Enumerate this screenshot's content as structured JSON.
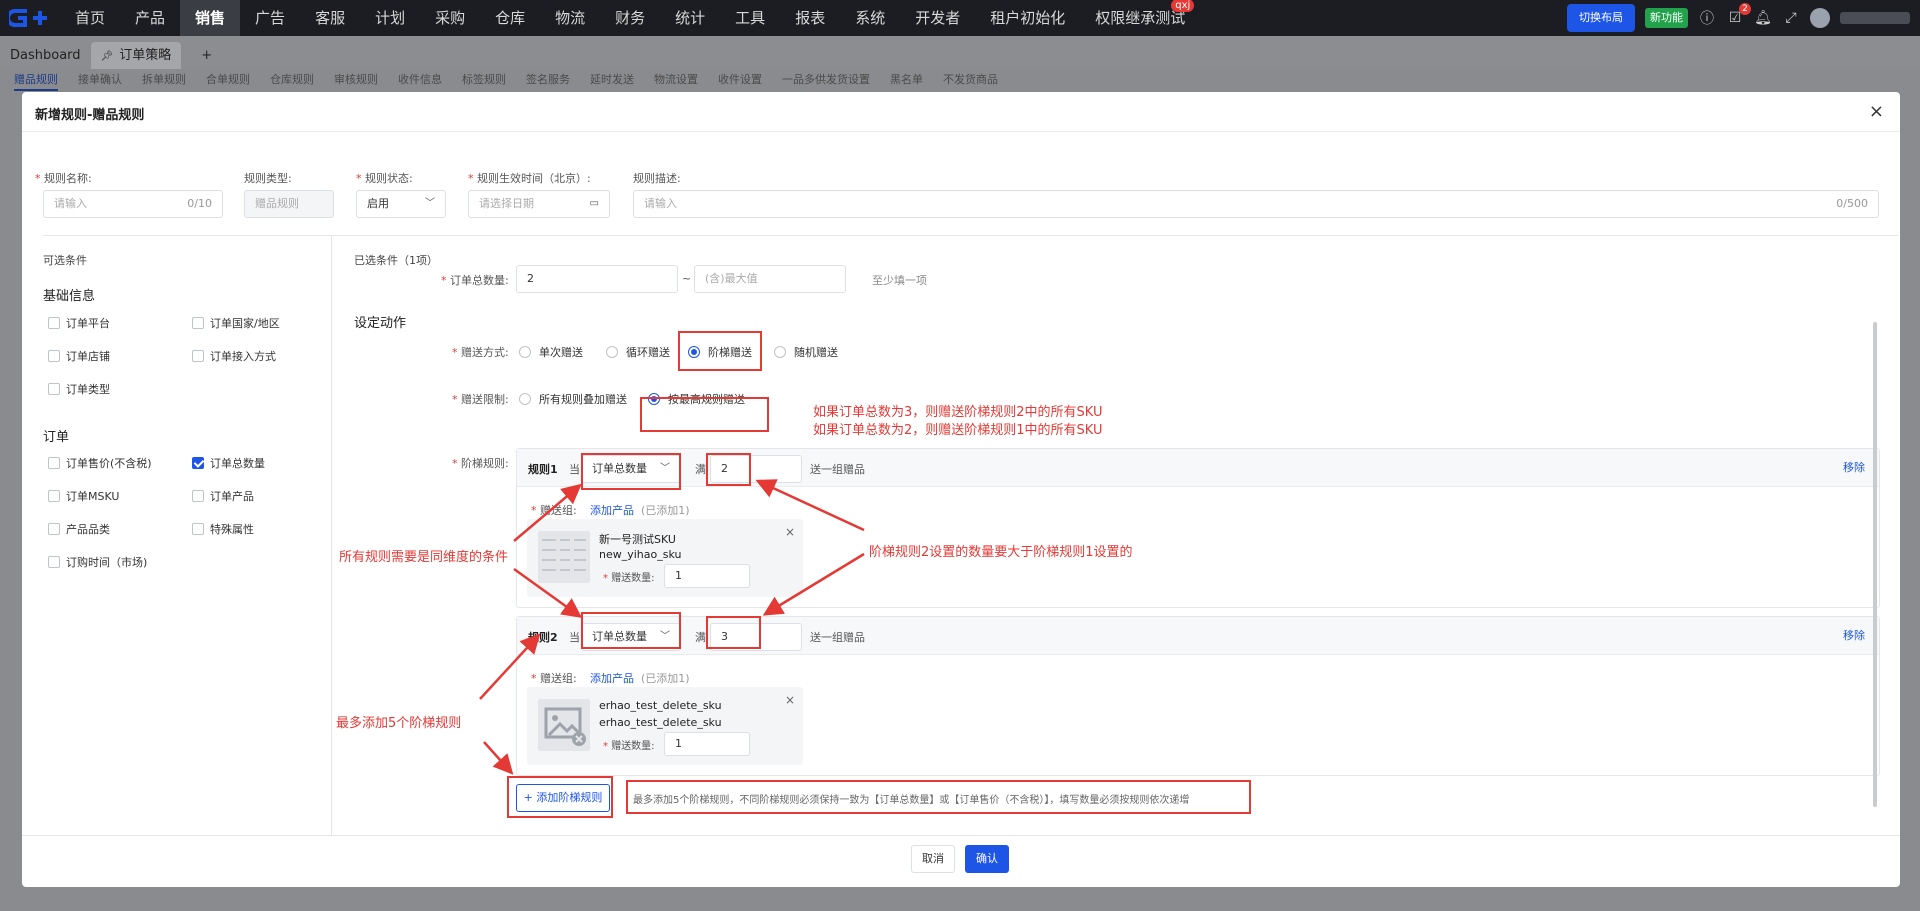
{
  "topnav": {
    "items": [
      "首页",
      "产品",
      "销售",
      "广告",
      "客服",
      "计划",
      "采购",
      "仓库",
      "物流",
      "财务",
      "统计",
      "工具",
      "报表",
      "系统",
      "开发者",
      "租户初始化",
      "权限继承测试"
    ],
    "active_index": 2,
    "badge_label": "qxj",
    "switch_layout": "切换布局",
    "new_feature": "新功能",
    "notification_count": "2"
  },
  "tabs": [
    {
      "label": "Dashboard"
    },
    {
      "label": "订单策略"
    }
  ],
  "add_tab": "+",
  "subtabs": [
    "赠品规则",
    "接单确认",
    "拆单规则",
    "合单规则",
    "仓库规则",
    "审核规则",
    "收件信息",
    "标签规则",
    "签名服务",
    "延时发送",
    "物流设置",
    "收件设置",
    "一品多供发货设置",
    "黑名单",
    "不发货商品"
  ],
  "modal": {
    "title": "新增规则-赠品规则",
    "close": "×",
    "fields": {
      "name_label": "规则名称:",
      "name_placeholder": "请输入",
      "name_count": "0/10",
      "type_label": "规则类型:",
      "type_value": "赠品规则",
      "status_label": "规则状态:",
      "status_value": "启用",
      "time_label": "规则生效时间（北京）:",
      "time_placeholder": "请选择日期",
      "desc_label": "规则描述:",
      "desc_placeholder": "请输入",
      "desc_count": "0/500",
      "required_mark": "*"
    },
    "left_panel": {
      "title": "可选条件",
      "groups": [
        {
          "title": "基础信息",
          "items": [
            {
              "label": "订单平台",
              "checked": false
            },
            {
              "label": "订单国家/地区",
              "checked": false
            },
            {
              "label": "订单店铺",
              "checked": false
            },
            {
              "label": "订单接入方式",
              "checked": false
            },
            {
              "label": "订单类型",
              "checked": false
            }
          ]
        },
        {
          "title": "订单",
          "items": [
            {
              "label": "订单售价(不含税)",
              "checked": false
            },
            {
              "label": "订单总数量",
              "checked": true
            },
            {
              "label": "订单MSKU",
              "checked": false
            },
            {
              "label": "订单产品",
              "checked": false
            },
            {
              "label": "产品品类",
              "checked": false
            },
            {
              "label": "特殊属性",
              "checked": false
            },
            {
              "label": "订购时间（市场)",
              "checked": false
            }
          ]
        }
      ]
    },
    "right_panel": {
      "selected_title": "已选条件（1项）",
      "order_qty_label": "订单总数量:",
      "order_qty_value": "2",
      "tilde": "~",
      "max_placeholder": "(含)最大值",
      "at_least_one": "至少填一项",
      "action_title": "设定动作",
      "gift_mode_label": "赠送方式:",
      "gift_modes": [
        "单次赠送",
        "循环赠送",
        "阶梯赠送",
        "随机赠送"
      ],
      "gift_mode_selected": 2,
      "gift_limit_label": "赠送限制:",
      "gift_limits": [
        "所有规则叠加赠送",
        "按最高规则赠送"
      ],
      "gift_limit_selected": 1,
      "ladder_label": "阶梯规则:",
      "rules": [
        {
          "name": "规则1",
          "when": "当",
          "condition": "订单总数量",
          "full": "满",
          "value": "2",
          "send": "送一组赠品",
          "remove": "移除",
          "group_label": "赠送组:",
          "add_product": "添加产品",
          "added": "(已添加1)",
          "product_name": "新一号测试SKU",
          "product_sku": "new_yihao_sku",
          "qty_label": "赠送数量:",
          "qty": "1",
          "remove_product": "×"
        },
        {
          "name": "规则2",
          "when": "当",
          "condition": "订单总数量",
          "full": "满",
          "value": "3",
          "send": "送一组赠品",
          "remove": "移除",
          "group_label": "赠送组:",
          "add_product": "添加产品",
          "added": "(已添加1)",
          "product_name": "erhao_test_delete_sku",
          "product_sku": "erhao_test_delete_sku",
          "qty_label": "赠送数量:",
          "qty": "1",
          "remove_product": "×"
        }
      ],
      "add_ladder": "+ 添加阶梯规则",
      "ladder_hint": "最多添加5个阶梯规则，不同阶梯规则必须保持一致为【订单总数量】或【订单售价（不含税）】，填写数量必须按规则依次递增"
    },
    "annotations": {
      "note1": "如果订单总数为3，则赠送阶梯规则2中的所有SKU",
      "note2": "如果订单总数为2，则赠送阶梯规则1中的所有SKU",
      "same_dimension": "所有规则需要是同维度的条件",
      "ladder_increase": "阶梯规则2设置的数量要大于阶梯规则1设置的",
      "max_five": "最多添加5个阶梯规则"
    },
    "footer": {
      "cancel": "取消",
      "confirm": "确认"
    }
  },
  "colors": {
    "primary": "#1d56e6",
    "annotation_red": "#e53935",
    "topnav_bg": "#1b1d22"
  }
}
